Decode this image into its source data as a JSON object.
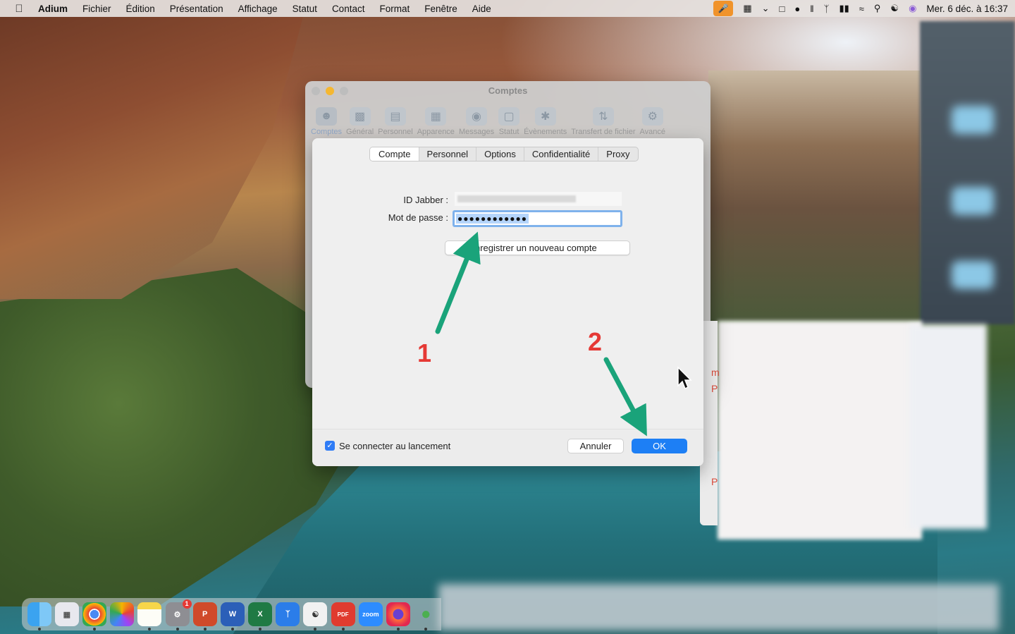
{
  "menubar": {
    "app": "Adium",
    "items": [
      "Fichier",
      "Édition",
      "Présentation",
      "Affichage",
      "Statut",
      "Contact",
      "Format",
      "Fenêtre",
      "Aide"
    ],
    "clock": "Mer. 6 déc. à 16:37"
  },
  "window": {
    "title": "Comptes",
    "toolbar": [
      "Comptes",
      "Général",
      "Personnel",
      "Apparence",
      "Messages",
      "Statut",
      "Évènements",
      "Transfert de fichier",
      "Avancé"
    ]
  },
  "sheet": {
    "tabs": [
      "Compte",
      "Personnel",
      "Options",
      "Confidentialité",
      "Proxy"
    ],
    "jabber_label": "ID Jabber :",
    "password_label": "Mot de passe :",
    "password_value": "●●●●●●●●●●●●",
    "register_button": "nregistrer un nouveau compte",
    "launch_checkbox": "Se connecter au lancement",
    "launch_checked": true,
    "cancel_button": "Annuler",
    "ok_button": "OK"
  },
  "annotations": {
    "step1": "1",
    "step2": "2",
    "arrow_color": "#1aa37a",
    "number_color": "#e53935"
  },
  "dock": {
    "badge": "1",
    "pdf_label": "PDF",
    "zoom_label": "zoom"
  }
}
